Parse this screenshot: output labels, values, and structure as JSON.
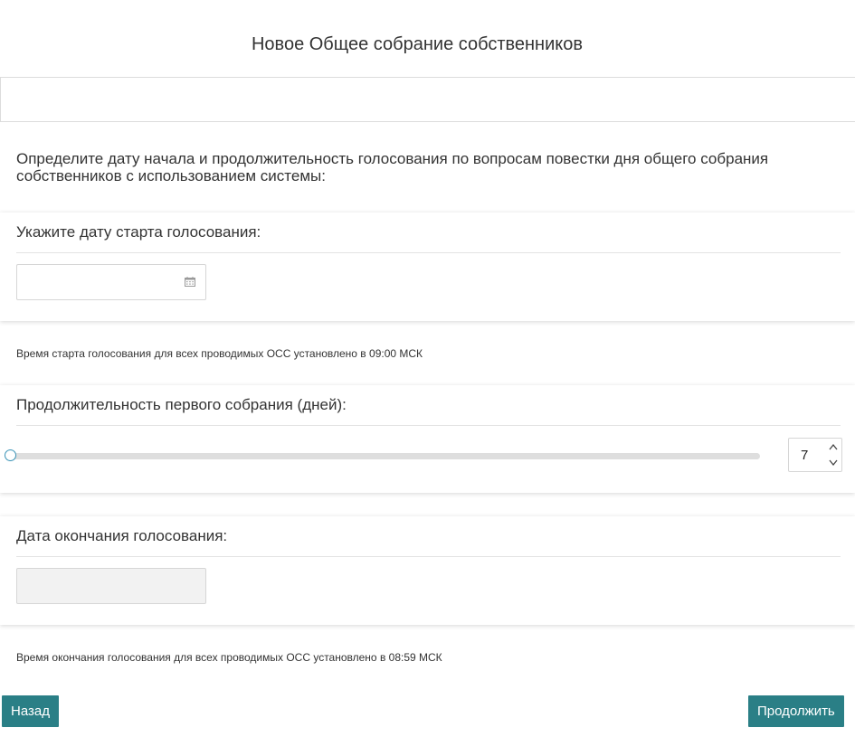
{
  "page": {
    "title": "Новое Общее собрание собственников",
    "intro": "Определите дату начала и продолжительность голосования по вопросам повестки дня общего собрания собственников с использованием системы:"
  },
  "start_section": {
    "heading": "Укажите дату старта голосования:",
    "date_value": "",
    "icon": "calendar-icon"
  },
  "start_note": "Время старта голосования для всех проводимых ОСС установлено в 09:00 МСК",
  "duration_section": {
    "heading": "Продолжительность первого собрания (дней):",
    "value": "7",
    "slider_level": 0
  },
  "end_section": {
    "heading": "Дата окончания голосования:",
    "date_value": ""
  },
  "end_note": "Время окончания голосования для всех проводимых ОСС установлено в 08:59 МСК",
  "buttons": {
    "back": "Назад",
    "next": "Продолжить"
  },
  "colors": {
    "accent": "#2a7f86",
    "slider_handle": "#3a93b6"
  }
}
